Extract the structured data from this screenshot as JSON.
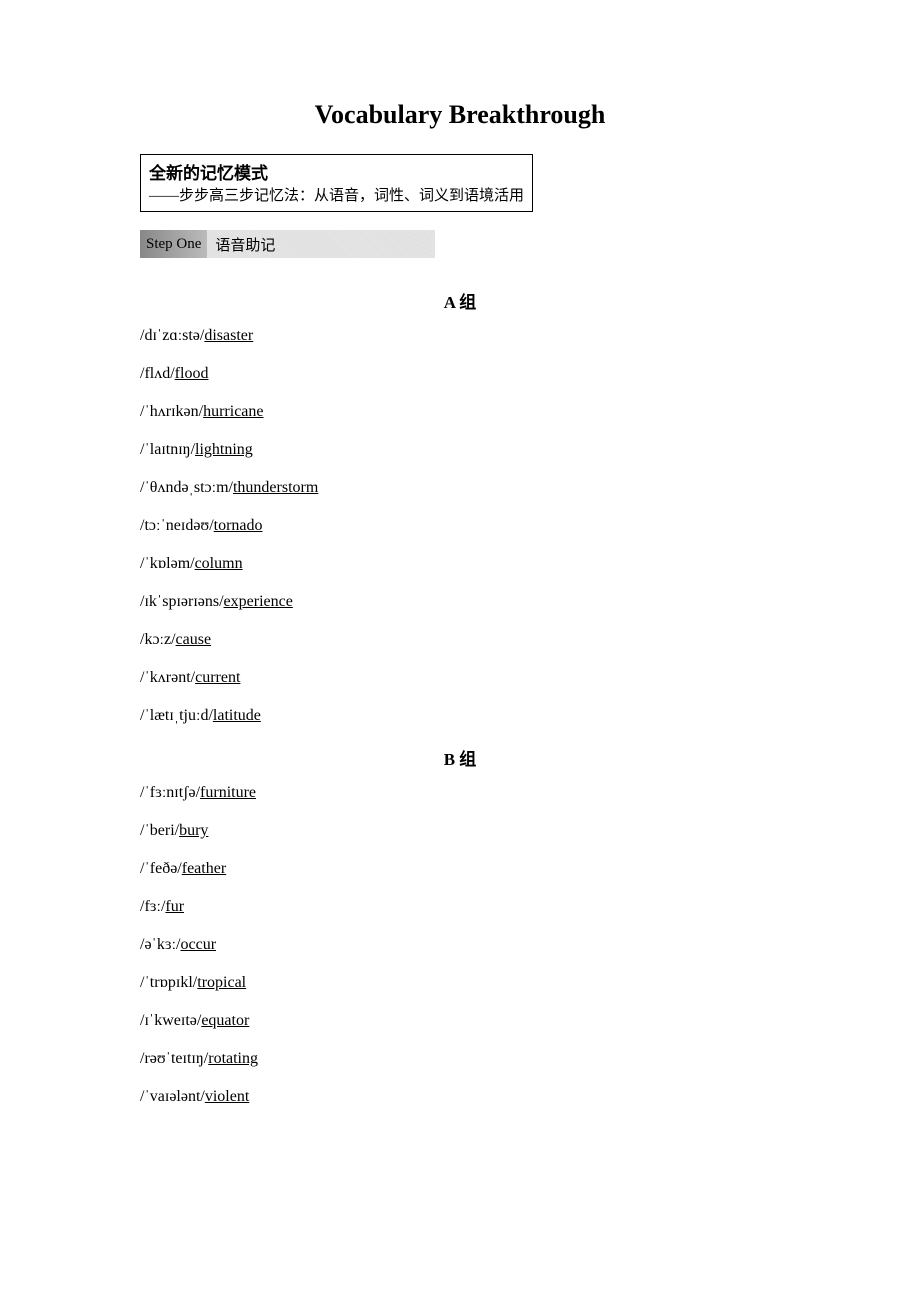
{
  "title": "Vocabulary Breakthrough",
  "memo": {
    "heading": "全新的记忆模式",
    "sub": "——步步高三步记忆法：从语音，词性、词义到语境活用"
  },
  "step": {
    "label": "Step One",
    "text": "语音助记"
  },
  "groups": [
    {
      "heading": "A 组",
      "entries": [
        {
          "ipa": "/dɪˈzɑːstə/",
          "word": "disaster"
        },
        {
          "ipa": "/flʌd/",
          "word": "flood"
        },
        {
          "ipa": "/ˈhʌrɪkən/",
          "word": "hurricane"
        },
        {
          "ipa": "/ˈlaɪtnɪŋ/",
          "word": "lightning"
        },
        {
          "ipa": "/ˈθʌndəˌstɔːm/",
          "word": "thunderstorm"
        },
        {
          "ipa": "/tɔːˈneɪdəʊ/",
          "word": "tornado"
        },
        {
          "ipa": "/ˈkɒləm/",
          "word": "column"
        },
        {
          "ipa": "/ɪkˈspɪərɪəns/",
          "word": "experience"
        },
        {
          "ipa": "/kɔːz/",
          "word": "cause"
        },
        {
          "ipa": "/ˈkʌrənt/",
          "word": "current"
        },
        {
          "ipa": "/ˈlætɪˌtjuːd/",
          "word": "latitude"
        }
      ]
    },
    {
      "heading": "B 组",
      "entries": [
        {
          "ipa": "/ˈfɜːnɪtʃə/",
          "word": "furniture"
        },
        {
          "ipa": "/ˈberi/",
          "word": "bury"
        },
        {
          "ipa": "/ˈfeðə/",
          "word": "feather"
        },
        {
          "ipa": "/fɜː/",
          "word": "fur"
        },
        {
          "ipa": "/əˈkɜː/",
          "word": "occur"
        },
        {
          "ipa": "/ˈtrɒpɪkl/",
          "word": "tropical"
        },
        {
          "ipa": "/ɪˈkweɪtə/",
          "word": "equator"
        },
        {
          "ipa": "/rəʊˈteɪtɪŋ/",
          "word": "rotating"
        },
        {
          "ipa": "/ˈvaɪələnt/",
          "word": "violent"
        }
      ]
    }
  ]
}
